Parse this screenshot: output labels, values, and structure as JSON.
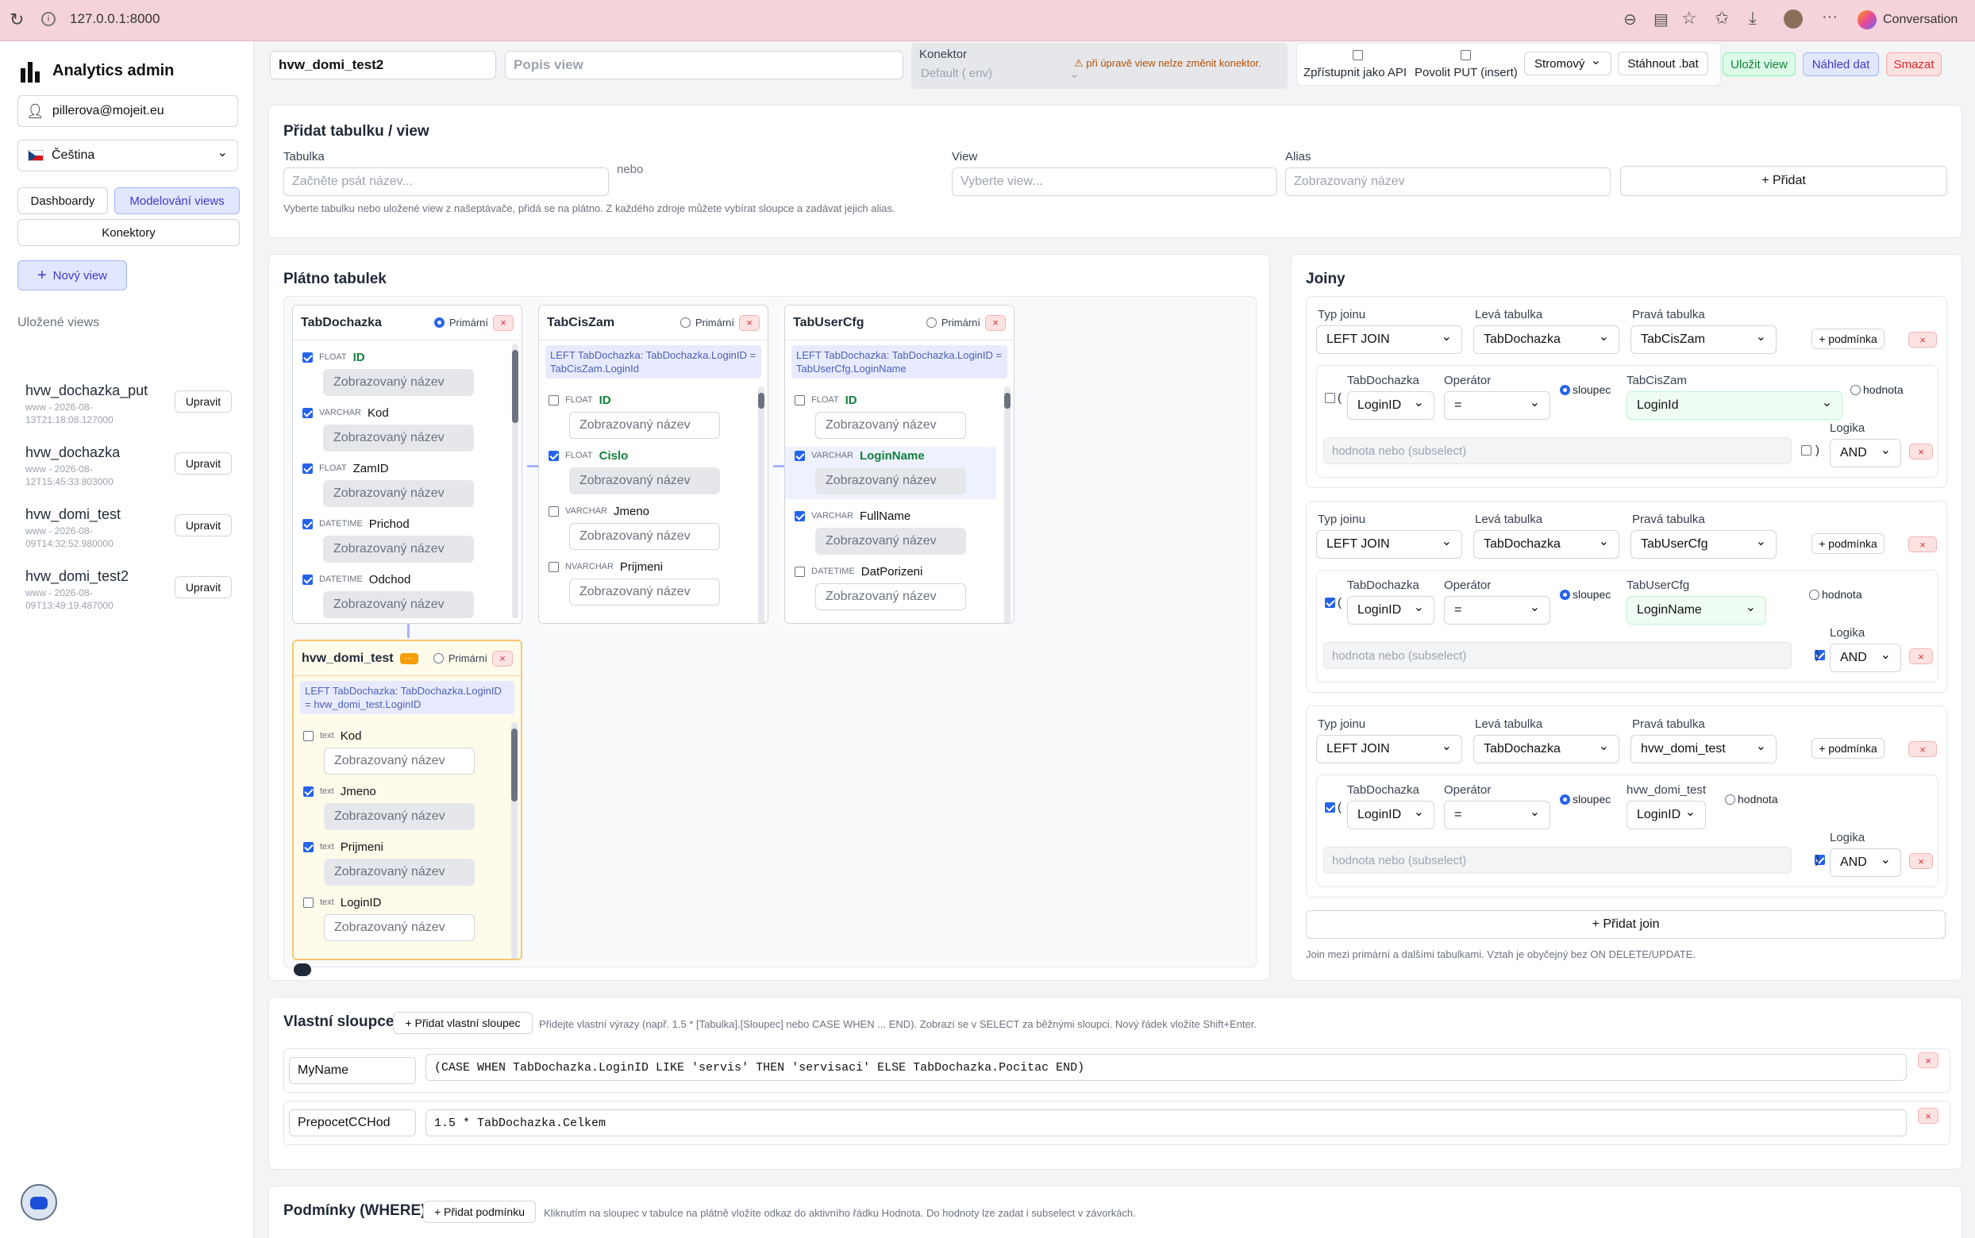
{
  "browser": {
    "url": "127.0.0.1:8000",
    "conversation_label": "Conversation"
  },
  "sidebar": {
    "app_title": "Analytics admin",
    "user_email": "pillerova@mojeit.eu",
    "language": "Čeština",
    "nav": {
      "dashboardy": "Dashboardy",
      "modelovani": "Modelování views",
      "konektory": "Konektory"
    },
    "new_view": "Nový view",
    "saved_title": "Uložené views",
    "saved": [
      {
        "name": "hvw_dochazka_put",
        "meta1": "www - 2026-08-",
        "meta2": "13T21:18:08.127000",
        "edit": "Upravit"
      },
      {
        "name": "hvw_dochazka",
        "meta1": "www - 2026-08-",
        "meta2": "12T15:45:33.803000",
        "edit": "Upravit"
      },
      {
        "name": "hvw_domi_test",
        "meta1": "www - 2026-08-",
        "meta2": "09T14:32:52.980000",
        "edit": "Upravit"
      },
      {
        "name": "hvw_domi_test2",
        "meta1": "www - 2026-08-",
        "meta2": "09T13:49:19.487000",
        "edit": "Upravit"
      }
    ]
  },
  "header": {
    "view_name": "hvw_domi_test2",
    "description_placeholder": "Popis view",
    "konektor_label": "Konektor",
    "konektor_value": "Default ( env)",
    "konektor_warning": "⚠ při úpravě view nelze změnit konektor.",
    "api_label": "Zpřístupnit jako API",
    "put_label": "Povolit PUT (insert)",
    "mode": "Stromový",
    "download": "Stáhnout .bat",
    "save": "Uložit view",
    "preview": "Náhled dat",
    "delete": "Smazat"
  },
  "add_table": {
    "title": "Přidat tabulku / view",
    "table_label": "Tabulka",
    "table_placeholder": "Začněte psát název...",
    "or": "nebo",
    "view_label": "View",
    "view_placeholder": "Vyberte view...",
    "alias_label": "Alias",
    "alias_placeholder": "Zobrazovaný název",
    "add_button": "+ Přidat",
    "hint": "Vyberte tabulku nebo uložené view z našeptávače, přidá se na plátno. Z každého zdroje můžete vybírat sloupce a zadávat jejich alias."
  },
  "canvas": {
    "title": "Plátno tabulek",
    "primary_label": "Primární",
    "alias_placeholder": "Zobrazovaný název",
    "tables": [
      {
        "name": "TabDochazka",
        "join": "",
        "columns": [
          {
            "type": "FLOAT",
            "name": "ID",
            "checked": true,
            "primary": true
          },
          {
            "type": "VARCHAR",
            "name": "Kod",
            "checked": true
          },
          {
            "type": "FLOAT",
            "name": "ZamID",
            "checked": true
          },
          {
            "type": "DATETIME",
            "name": "Prichod",
            "checked": true
          },
          {
            "type": "DATETIME",
            "name": "Odchod",
            "checked": true
          }
        ]
      },
      {
        "name": "TabCisZam",
        "join": "LEFT TabDochazka: TabDochazka.LoginID = TabCisZam.LoginId",
        "columns": [
          {
            "type": "FLOAT",
            "name": "ID",
            "checked": false,
            "primary": true
          },
          {
            "type": "FLOAT",
            "name": "Cislo",
            "checked": true,
            "primary": true
          },
          {
            "type": "VARCHAR",
            "name": "Jmeno",
            "checked": false
          },
          {
            "type": "NVARCHAR",
            "name": "Prijmeni",
            "checked": false
          }
        ]
      },
      {
        "name": "TabUserCfg",
        "join": "LEFT TabDochazka: TabDochazka.LoginID = TabUserCfg.LoginName",
        "columns": [
          {
            "type": "FLOAT",
            "name": "ID",
            "checked": false,
            "primary": true
          },
          {
            "type": "VARCHAR",
            "name": "LoginName",
            "checked": true,
            "primary": true
          },
          {
            "type": "VARCHAR",
            "name": "FullName",
            "checked": true
          },
          {
            "type": "DATETIME",
            "name": "DatPorizeni",
            "checked": false
          }
        ]
      },
      {
        "name": "hvw_domi_test",
        "join": "LEFT TabDochazka: TabDochazka.LoginID = hvw_domi_test.LoginID",
        "columns": [
          {
            "type": "text",
            "name": "Kod",
            "checked": false
          },
          {
            "type": "text",
            "name": "Jmeno",
            "checked": true
          },
          {
            "type": "text",
            "name": "Prijmeni",
            "checked": true
          },
          {
            "type": "text",
            "name": "LoginID",
            "checked": false
          }
        ]
      }
    ]
  },
  "joins": {
    "title": "Joiny",
    "type_label": "Typ joinu",
    "left_label": "Levá tabulka",
    "right_label": "Pravá tabulka",
    "add_condition": "+ podmínka",
    "operator_label": "Operátor",
    "column_label": "sloupec",
    "value_label": "hodnota",
    "logic_label": "Logika",
    "value_placeholder": "hodnota nebo (subselect)",
    "add_join": "+ Přidat join",
    "hint": "Join mezi primární a dalšími tabulkami. Vztah je obyčejný bez ON DELETE/UPDATE.",
    "items": [
      {
        "type": "LEFT JOIN",
        "left": "TabDochazka",
        "right": "TabCisZam",
        "left_col": "LoginID",
        "op": "=",
        "right_col": "LoginId",
        "logic": "AND"
      },
      {
        "type": "LEFT JOIN",
        "left": "TabDochazka",
        "right": "TabUserCfg",
        "left_col": "LoginID",
        "op": "=",
        "right_col": "LoginName",
        "logic": "AND"
      },
      {
        "type": "LEFT JOIN",
        "left": "TabDochazka",
        "right": "hvw_domi_test",
        "left_col": "LoginID",
        "op": "=",
        "right_col": "LoginID",
        "logic": "AND"
      }
    ]
  },
  "custom": {
    "title": "Vlastní sloupce",
    "add": "+ Přidat vlastní sloupec",
    "hint": "Přidejte vlastní výrazy (např. 1.5 * [Tabulka].[Sloupec] nebo CASE WHEN ... END). Zobrazí se v SELECT za běžnými sloupci. Nový řádek vložíte Shift+Enter.",
    "rows": [
      {
        "alias": "MyName",
        "expr": "(CASE WHEN TabDochazka.LoginID LIKE 'servis' THEN 'servisaci' ELSE TabDochazka.Pocitac END)"
      },
      {
        "alias": "PrepocetCCHod",
        "expr": "1.5 * TabDochazka.Celkem"
      }
    ]
  },
  "where": {
    "title": "Podmínky (WHERE)",
    "add": "+ Přidat podmínku",
    "hint": "Kliknutím na sloupec v tabulce na plátně vložíte odkaz do aktivního řádku Hodnota. Do hodnoty lze zadat i subselect v závorkách."
  },
  "colors": {
    "accent": "#2563eb",
    "success": "#15803d",
    "danger": "#dc2626"
  }
}
